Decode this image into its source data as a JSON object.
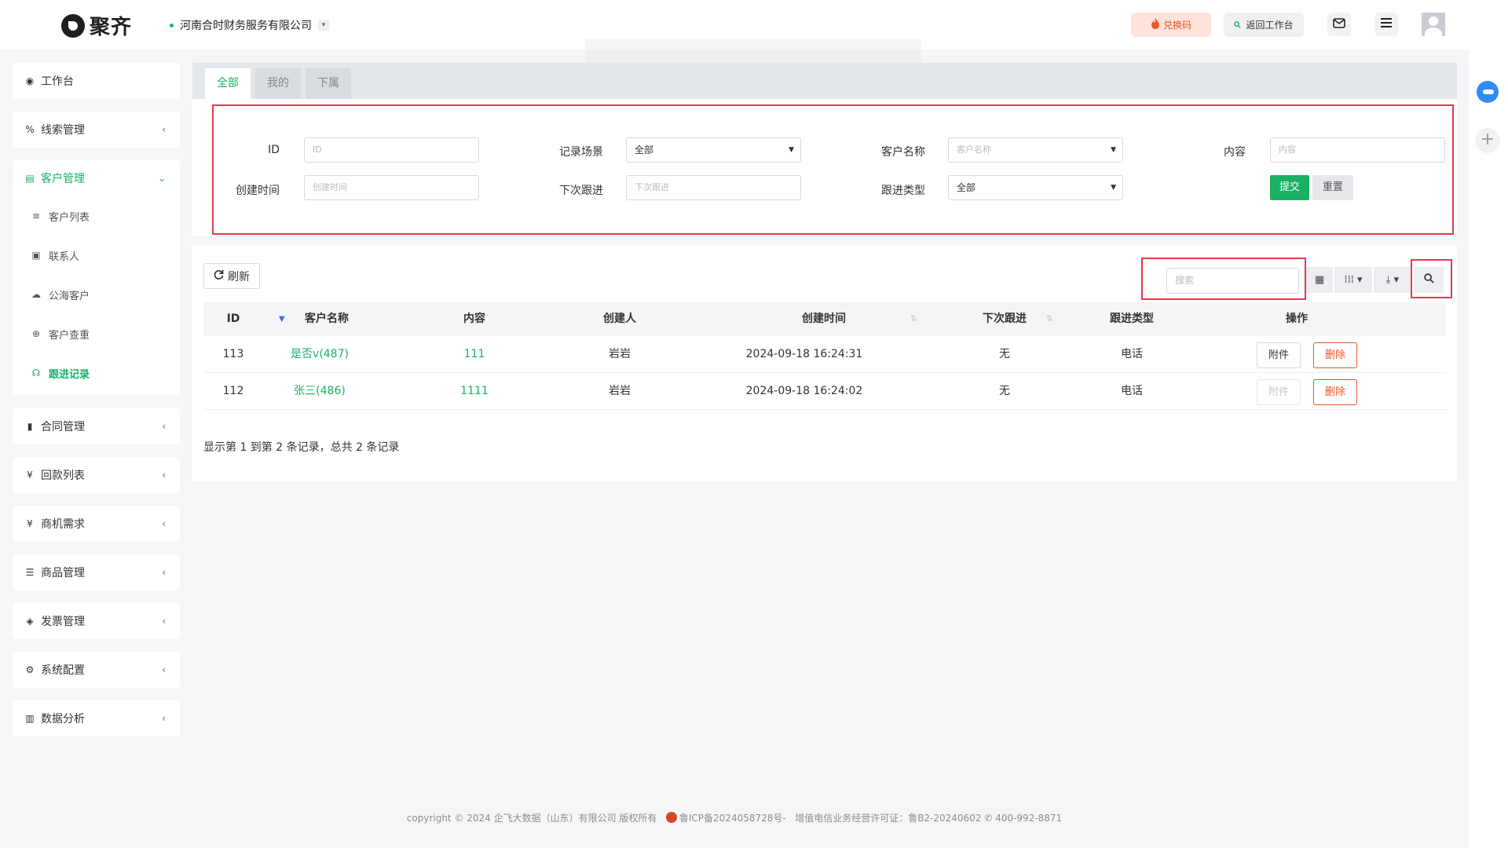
{
  "header": {
    "logo_text": "聚齐",
    "company_name": "河南合时财务服务有限公司",
    "company_caret": "▾",
    "exchange_label": "兑换码",
    "back_label": "返回工作台"
  },
  "sidebar": {
    "workspace": "工作台",
    "leads": "线索管理",
    "customer_mgmt": "客户管理",
    "customer_sub": [
      "客户列表",
      "联系人",
      "公海客户",
      "客户查重",
      "跟进记录"
    ],
    "contract": "合同管理",
    "payments": "回款列表",
    "opportunity": "商机需求",
    "products": "商品管理",
    "invoice": "发票管理",
    "system": "系统配置",
    "analytics": "数据分析"
  },
  "tabs": [
    "全部",
    "我的",
    "下属"
  ],
  "filters": {
    "id_label": "ID",
    "id_placeholder": "ID",
    "scene_label": "记录场景",
    "scene_value": "全部",
    "customer_label": "客户名称",
    "customer_placeholder": "客户名称",
    "content_label": "内容",
    "content_placeholder": "内容",
    "created_label": "创建时间",
    "created_placeholder": "创建时间",
    "next_label": "下次跟进",
    "next_placeholder": "下次跟进",
    "type_label": "跟进类型",
    "type_value": "全部",
    "submit_label": "提交",
    "reset_label": "重置"
  },
  "toolbar": {
    "refresh_label": "刷新",
    "search_placeholder": "搜索"
  },
  "table": {
    "columns": [
      "ID",
      "客户名称",
      "内容",
      "创建人",
      "创建时间",
      "下次跟进",
      "跟进类型",
      "操作"
    ],
    "rows": [
      {
        "id": "113",
        "customer": "是否v(487)",
        "content": "111",
        "creator": "岩岩",
        "created": "2024-09-18 16:24:31",
        "next": "无",
        "type": "电话",
        "attach": "附件",
        "delete": "删除"
      },
      {
        "id": "112",
        "customer": "张三(486)",
        "content": "1111",
        "creator": "岩岩",
        "created": "2024-09-18 16:24:02",
        "next": "无",
        "type": "电话",
        "attach": "附件",
        "delete": "删除"
      }
    ],
    "summary": "显示第 1 到第 2 条记录，总共 2 条记录"
  },
  "footer": {
    "copyright": "copyright © 2024 企飞大数据（山东）有限公司 版权所有",
    "icp": "鲁ICP备2024058728号-",
    "license": "增值电信业务经营许可证：鲁B2-20240602",
    "phone": "400-992-8871"
  },
  "colors": {
    "accent": "#19b164",
    "danger": "#e7542a",
    "highlight": "#e23a4f"
  }
}
